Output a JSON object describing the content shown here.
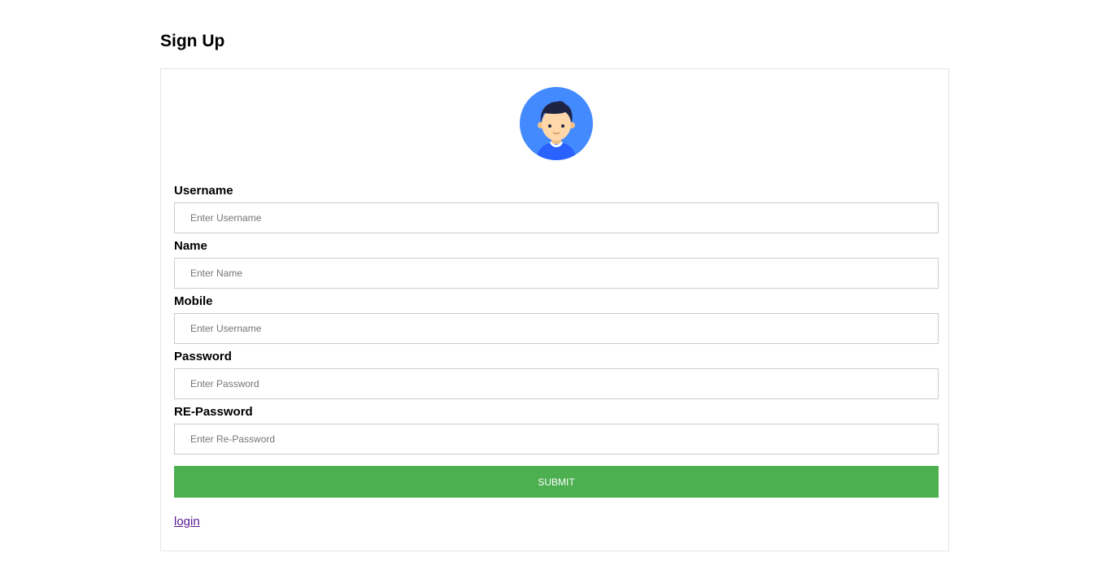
{
  "page": {
    "title": "Sign Up"
  },
  "avatar": {
    "icon": "user-avatar-icon",
    "background_color": "#448aff"
  },
  "form": {
    "fields": [
      {
        "label": "Username",
        "placeholder": "Enter Username",
        "value": ""
      },
      {
        "label": "Name",
        "placeholder": "Enter Name",
        "value": ""
      },
      {
        "label": "Mobile",
        "placeholder": "Enter Username",
        "value": ""
      },
      {
        "label": "Password",
        "placeholder": "Enter Password",
        "value": ""
      },
      {
        "label": "RE-Password",
        "placeholder": "Enter Re-Password",
        "value": ""
      }
    ],
    "submit_label": "SUBMIT",
    "submit_color": "#4caf50",
    "login_link": "login",
    "login_link_color": "#551a8b"
  }
}
